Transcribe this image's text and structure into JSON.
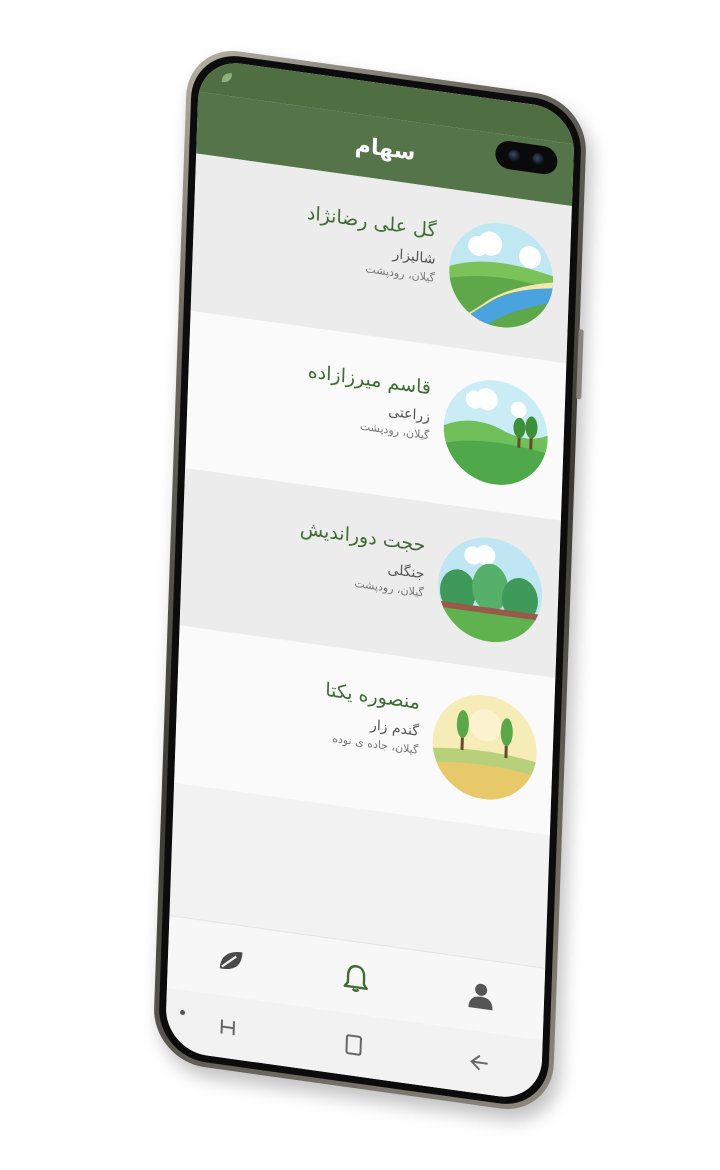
{
  "app": {
    "title": "سهام"
  },
  "farms": [
    {
      "name": "گل علی رضانژاد",
      "type": "شالیزار",
      "location": "گیلان، رودپشت",
      "image_icon": "river-landscape-icon"
    },
    {
      "name": "قاسم میرزازاده",
      "type": "زراعتی",
      "location": "گیلان، رودپشت",
      "image_icon": "hills-landscape-icon"
    },
    {
      "name": "حجت دوراندیش",
      "type": "جنگلی",
      "location": "گیلان، رودپشت",
      "image_icon": "forest-landscape-icon"
    },
    {
      "name": "منصوره یکتا",
      "type": "گندم زار",
      "location": "گیلان، جاده ی نوده",
      "image_icon": "wheat-field-icon"
    }
  ],
  "bottom_nav": [
    {
      "icon": "leaf-icon"
    },
    {
      "icon": "bell-icon",
      "active": true
    },
    {
      "icon": "user-icon"
    }
  ],
  "colors": {
    "primary": "#567449",
    "title_text": "#3f6b34",
    "card_alt": "#ececec"
  }
}
